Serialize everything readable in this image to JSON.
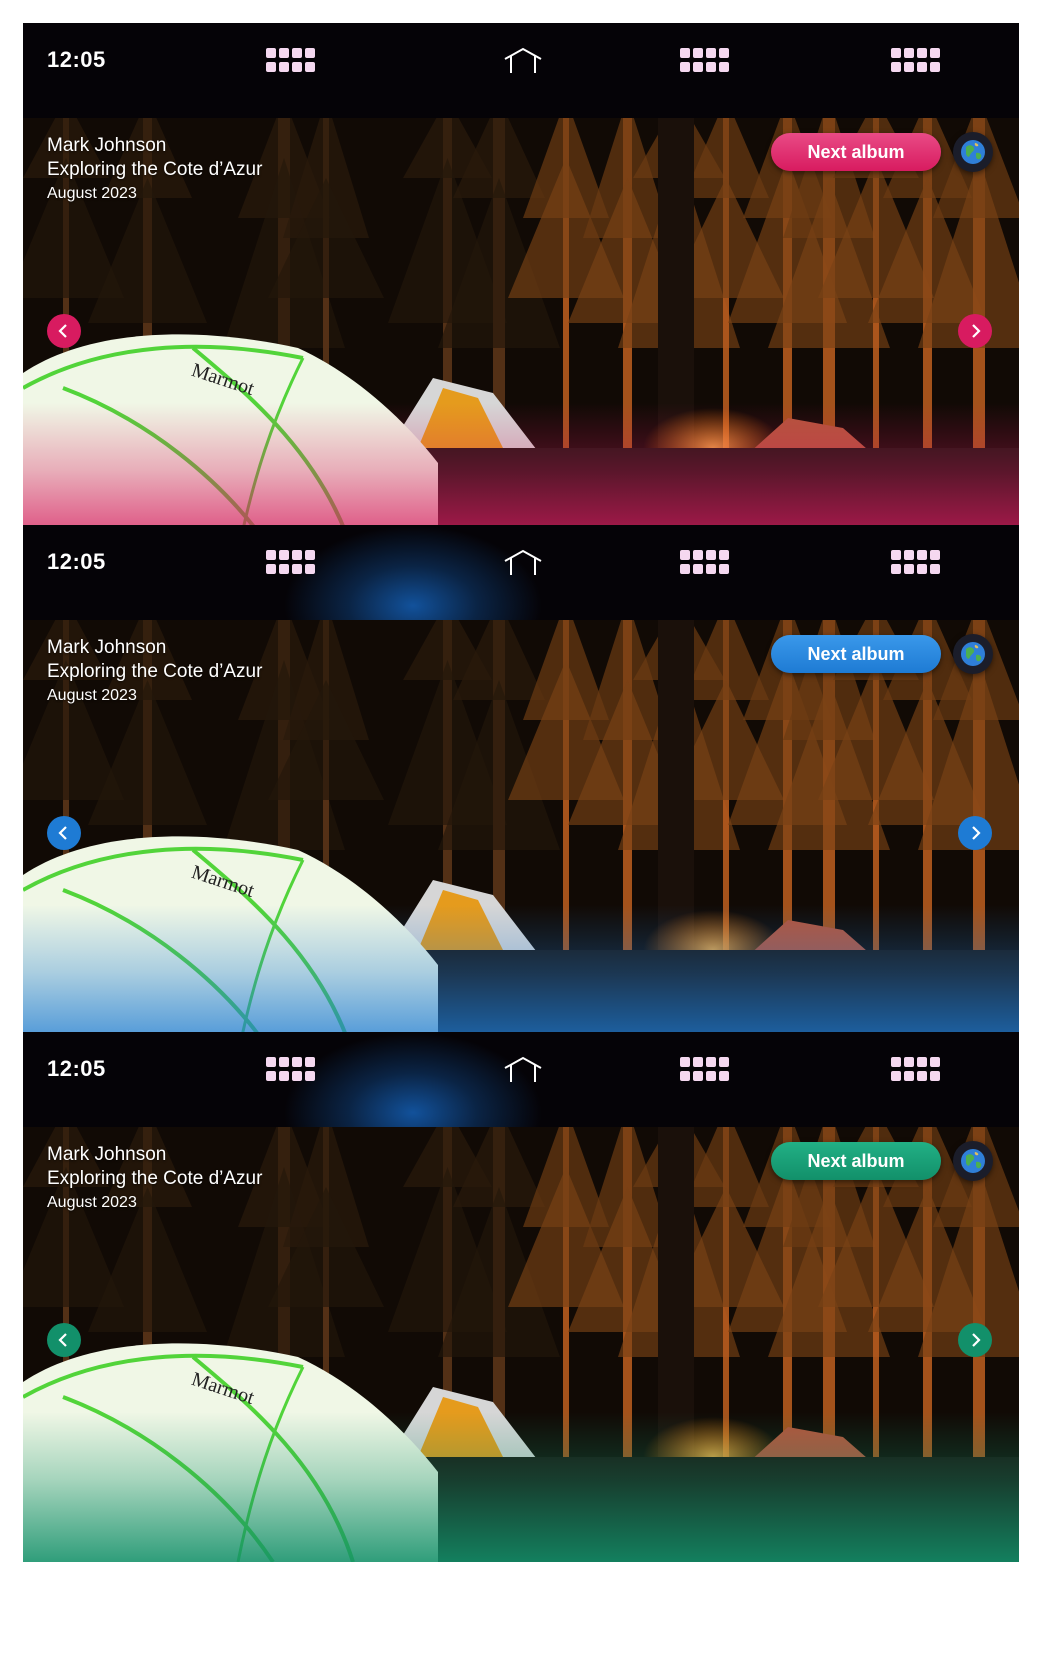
{
  "variants": [
    {
      "theme": "pink",
      "accent": "#d81b60",
      "accent_light": "#e94b86",
      "glow": "",
      "time": "12:05",
      "author": "Mark Johnson",
      "album": "Exploring the Cote d’Azur",
      "date": "August 2023",
      "next_label": "Next album",
      "icons": [
        "apps-grid-icon",
        "home-icon",
        "apps-grid-icon",
        "apps-grid-icon",
        "globe-icon",
        "chevron-left-icon",
        "chevron-right-icon"
      ]
    },
    {
      "theme": "blue",
      "accent": "#1e7bd4",
      "accent_light": "#3a98ea",
      "glow": "#1565c0",
      "time": "12:05",
      "author": "Mark Johnson",
      "album": "Exploring the Cote d’Azur",
      "date": "August 2023",
      "next_label": "Next album",
      "icons": [
        "apps-grid-icon",
        "home-icon",
        "apps-grid-icon",
        "apps-grid-icon",
        "globe-icon",
        "chevron-left-icon",
        "chevron-right-icon"
      ]
    },
    {
      "theme": "green",
      "accent": "#12906a",
      "accent_light": "#22b085",
      "glow": "#1565c0",
      "time": "12:05",
      "author": "Mark Johnson",
      "album": "Exploring the Cote d’Azur",
      "date": "August 2023",
      "next_label": "Next album",
      "icons": [
        "apps-grid-icon",
        "home-icon",
        "apps-grid-icon",
        "apps-grid-icon",
        "globe-icon",
        "chevron-left-icon",
        "chevron-right-icon"
      ]
    }
  ],
  "tent_brand": "Marmot"
}
